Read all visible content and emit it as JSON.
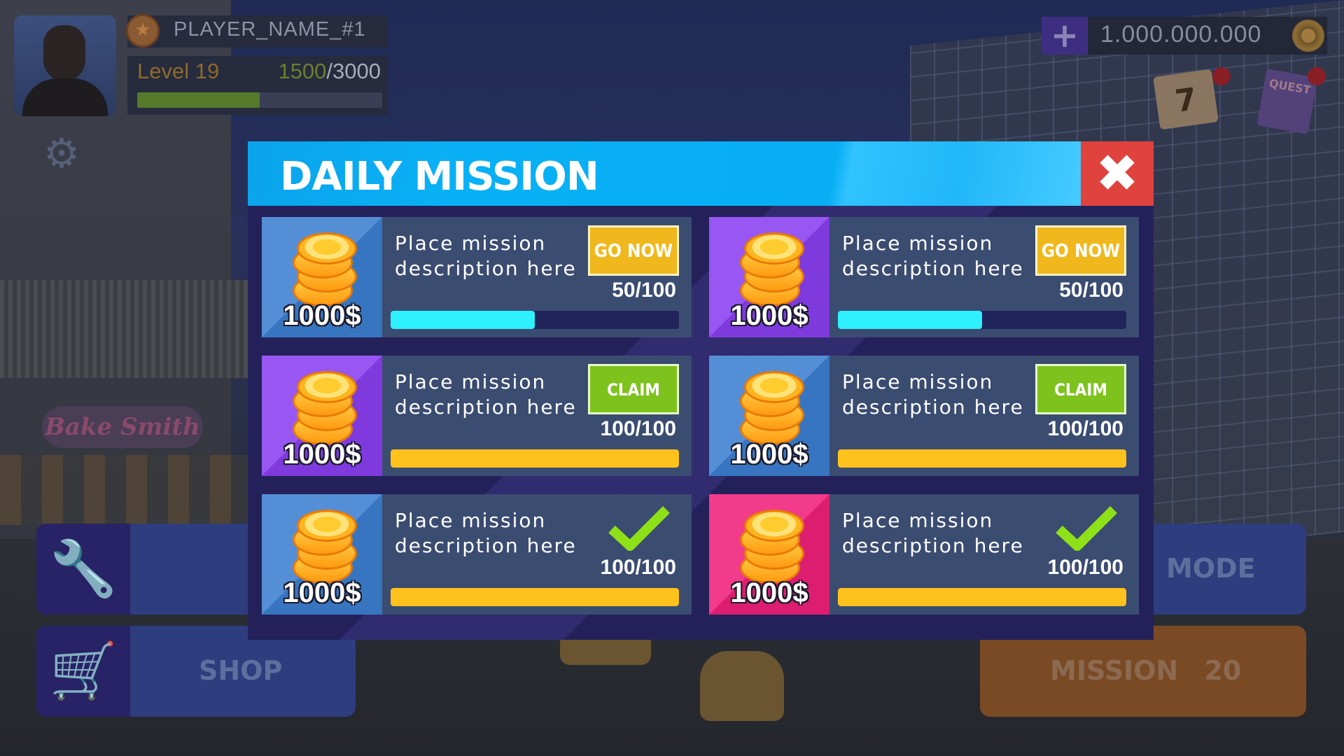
{
  "hud": {
    "player_name": "PLAYER_NAME_#1",
    "level_label": "Level 19",
    "xp_current": "1500",
    "xp_max": "/3000",
    "xp_fraction": 0.5,
    "currency_amount": "1.000.000.000",
    "calendar_day": "7",
    "quest_label": "QUEST"
  },
  "menu": {
    "shop_label": "SHOP",
    "mode_label": "MODE",
    "mission_label": "MISSION",
    "mission_number": "20"
  },
  "background": {
    "store_sign": "Bake Smith"
  },
  "dialog": {
    "title": "DAILY MISSION",
    "missions": [
      {
        "reward": "1000$",
        "reward_color": "#3d7fd0",
        "description": "Place mission description here",
        "action": "GO NOW",
        "state": "in_progress",
        "progress": "50/100",
        "fraction": 0.5,
        "bar_color": "#2ef0ff"
      },
      {
        "reward": "1000$",
        "reward_color": "#8a3ff0",
        "description": "Place mission description here",
        "action": "GO NOW",
        "state": "in_progress",
        "progress": "50/100",
        "fraction": 0.5,
        "bar_color": "#2ef0ff"
      },
      {
        "reward": "1000$",
        "reward_color": "#8a3ff0",
        "description": "Place mission description here",
        "action": "CLAIM",
        "state": "claimable",
        "progress": "100/100",
        "fraction": 1.0,
        "bar_color": "#ffc21c"
      },
      {
        "reward": "1000$",
        "reward_color": "#3d7fd0",
        "description": "Place mission description here",
        "action": "CLAIM",
        "state": "claimable",
        "progress": "100/100",
        "fraction": 1.0,
        "bar_color": "#ffc21c"
      },
      {
        "reward": "1000$",
        "reward_color": "#3d7fd0",
        "description": "Place mission description here",
        "action": "",
        "state": "completed",
        "progress": "100/100",
        "fraction": 1.0,
        "bar_color": "#ffc21c"
      },
      {
        "reward": "1000$",
        "reward_color": "#f0207a",
        "description": "Place mission description here",
        "action": "",
        "state": "completed",
        "progress": "100/100",
        "fraction": 1.0,
        "bar_color": "#ffc21c"
      }
    ]
  },
  "colors": {
    "header_blue": "#0aa4ec",
    "close_red": "#e0433e",
    "go_now_yellow": "#f0b81c",
    "claim_green": "#7ec21e",
    "check_green": "#8ee018",
    "progress_cyan": "#2ef0ff",
    "progress_gold": "#ffc21c"
  }
}
